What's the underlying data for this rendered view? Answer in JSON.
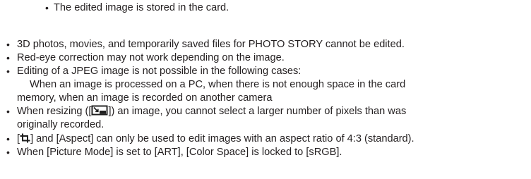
{
  "top_note": "The edited image is stored in the card.",
  "bullet_char": "•",
  "notes": {
    "n1": "3D photos, movies, and temporarily saved files for PHOTO STORY cannot be edited.",
    "n2": "Red-eye correction may not work depending on the image.",
    "n3": "Editing of a JPEG image is not possible in the following cases:",
    "n3_sub1": "When an image is processed on a PC, when there is not enough space in the card",
    "n3_sub2": "memory, when an image is recorded on another camera",
    "n4_prefix": "When resizing ([",
    "n4_suffix": "]) an image, you cannot select a larger number of pixels than was",
    "n4_cont": "originally recorded.",
    "n5_prefix": "[",
    "n5_suffix": "] and [Aspect] can only be used to edit images with an aspect ratio of 4:3 (standard).",
    "n6": "When [Picture Mode] is set to [ART], [Color Space] is locked to [sRGB]."
  },
  "icons": {
    "resize": "resize-icon",
    "trim": "trim-icon"
  }
}
